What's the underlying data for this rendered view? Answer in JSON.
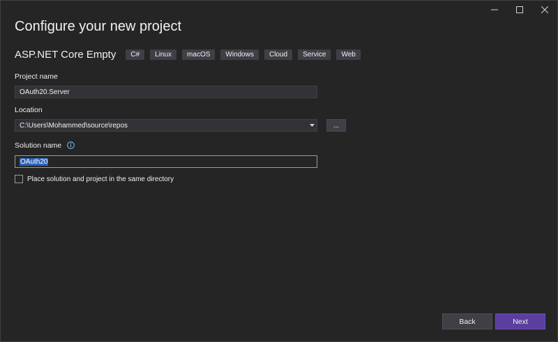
{
  "window": {
    "controls": [
      "minimize",
      "maximize",
      "close"
    ]
  },
  "title": "Configure your new project",
  "template": {
    "name": "ASP.NET Core Empty",
    "tags": [
      "C#",
      "Linux",
      "macOS",
      "Windows",
      "Cloud",
      "Service",
      "Web"
    ]
  },
  "project_name": {
    "label": "Project name",
    "value": "OAuth20.Server"
  },
  "location": {
    "label": "Location",
    "value": "C:\\Users\\Mohammed\\source\\repos",
    "browse_label": "..."
  },
  "solution_name": {
    "label": "Solution name",
    "value": "OAuth20"
  },
  "same_directory": {
    "label": "Place solution and project in the same directory",
    "checked": false
  },
  "footer": {
    "back_label": "Back",
    "next_label": "Next"
  },
  "colors": {
    "background": "#252526",
    "accent": "#5b3fa0",
    "selection": "#2962b8"
  }
}
